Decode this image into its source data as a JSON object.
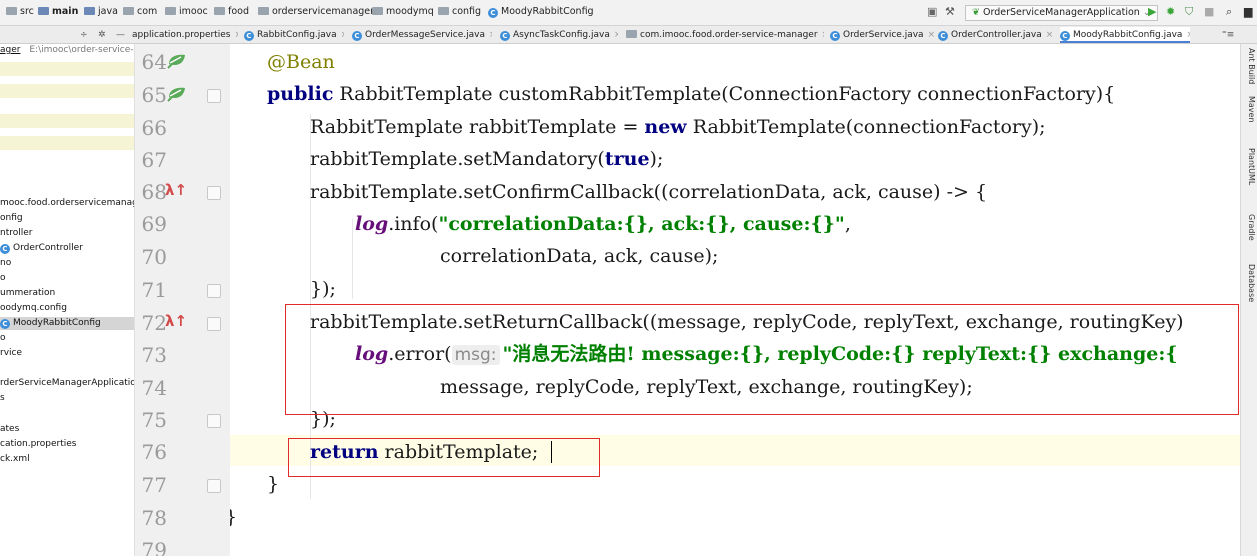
{
  "navbar": {
    "crumbs": [
      "src",
      "main",
      "java",
      "com",
      "imooc",
      "food",
      "orderservicemanager",
      "moodymq",
      "config",
      "MoodyRabbitConfig"
    ],
    "run_config": "OrderServiceManagerApplication",
    "run_config_icon": "spring-leaf-icon",
    "toolbar_icons": [
      "run-icon",
      "debug-icon",
      "coverage-icon",
      "stop-icon",
      "search-icon"
    ]
  },
  "tabs": [
    {
      "label": "application.properties",
      "active": false
    },
    {
      "label": "RabbitConfig.java",
      "active": false
    },
    {
      "label": "OrderMessageService.java",
      "active": false
    },
    {
      "label": "AsyncTaskConfig.java",
      "active": false
    },
    {
      "label": "com.imooc.food.order-service-manager",
      "active": false
    },
    {
      "label": "OrderService.java",
      "active": false
    },
    {
      "label": "OrderController.java",
      "active": false
    },
    {
      "label": "MoodyRabbitConfig.java",
      "active": true
    }
  ],
  "project": {
    "root_label": "ager",
    "root_path": "E:\\imooc\\order-service-ma",
    "items": [
      "mooc.food.orderservicemanage",
      "onfig",
      "ntroller",
      "OrderController",
      "no",
      "o",
      "ummeration",
      "oodymq.config",
      "MoodyRabbitConfig",
      "o",
      "rvice",
      "",
      "rderServiceManagerApplication",
      "s",
      "",
      "ates",
      "cation.properties",
      "ck.xml"
    ],
    "selected": "MoodyRabbitConfig"
  },
  "editor": {
    "line_numbers": [
      "64",
      "65",
      "66",
      "67",
      "68",
      "69",
      "70",
      "71",
      "72",
      "73",
      "74",
      "75",
      "76",
      "77",
      "78",
      "79"
    ],
    "lines": {
      "l64": {
        "ann": "@Bean"
      },
      "l65": {
        "kw": "public",
        "rest": " RabbitTemplate customRabbitTemplate(ConnectionFactory connectionFactory){"
      },
      "l66": {
        "a": "RabbitTemplate rabbitTemplate = ",
        "kw": "new",
        "b": " RabbitTemplate(connectionFactory);"
      },
      "l67": {
        "a": "rabbitTemplate.setMandatory(",
        "kw": "true",
        "b": ");"
      },
      "l68": {
        "a": "rabbitTemplate.setConfirmCallback((correlationData, ack, cause) -> {"
      },
      "l69": {
        "fld": "log",
        "a": ".info(",
        "str": "\"correlationData:{}, ack:{}, cause:{}\"",
        "b": ","
      },
      "l70": {
        "a": "correlationData, ack, cause);"
      },
      "l71": {
        "a": "});"
      },
      "l72": {
        "a": "rabbitTemplate.setReturnCallback((message, replyCode, replyText, exchange, routingKey)"
      },
      "l73": {
        "fld": "log",
        "a": ".error(",
        "hint": "msg:",
        "str": "\"消息无法路由! message:{}, replyCode:{} replyText:{} exchange:{"
      },
      "l74": {
        "a": "message, replyCode, replyText, exchange, routingKey);"
      },
      "l75": {
        "a": "});"
      },
      "l76": {
        "kw": "return",
        "a": " rabbitTemplate;"
      },
      "l77": {
        "a": "}"
      },
      "l78": {
        "a": "}"
      }
    }
  },
  "right_strip": [
    "Ant Build",
    "Maven",
    "PlantUML",
    "Gradle",
    "Database"
  ],
  "colors": {
    "keyword": "#000080",
    "string": "#008000",
    "annotation": "#808000",
    "field": "#660e7a",
    "highlight_box": "#e02b2b"
  }
}
